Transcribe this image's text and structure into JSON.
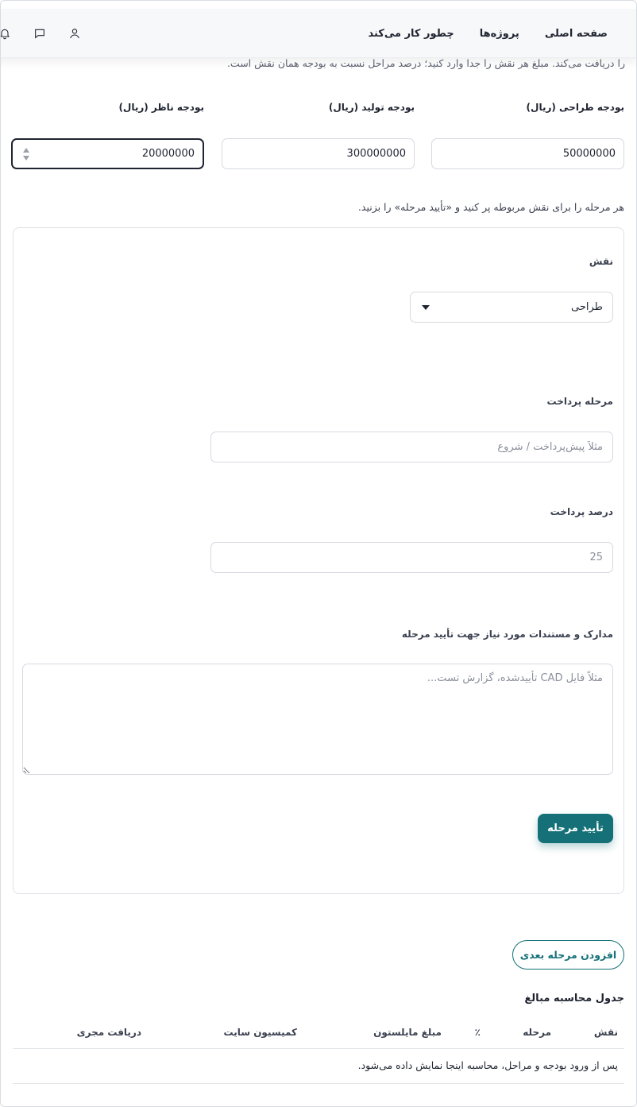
{
  "header": {
    "nav": [
      {
        "label": "صفحه اصلی"
      },
      {
        "label": "پروژه‌ها"
      },
      {
        "label": "چطور کار می‌کند"
      }
    ],
    "icons": [
      "user-icon",
      "message-icon",
      "bell-icon"
    ]
  },
  "intro": {
    "text": "را دریافت می‌کند. مبلغ هر نقش را جدا وارد کنید؛ درصد مراحل نسبت به بودجه همان نقش است."
  },
  "budgets": {
    "design": {
      "label": "بودجه طراحی (ریال)",
      "value": "50000000"
    },
    "production": {
      "label": "بودجه تولید (ریال)",
      "value": "300000000"
    },
    "supervisor": {
      "label": "بودجه ناظر (ریال)",
      "value": "20000000"
    }
  },
  "hint": "هر مرحله را برای نقش مربوطه پر کنید و «تأیید مرحله» را بزنید.",
  "stage_form": {
    "role_label": "نقش",
    "role_value": "طراحی",
    "stage_label": "مرحله پرداخت",
    "stage_placeholder": "مثلاً پیش‌پرداخت / شروع",
    "percent_label": "درصد پرداخت",
    "percent_placeholder": "25",
    "docs_label": "مدارک و مستندات مورد نیاز جهت تأیید مرحله",
    "docs_placeholder": "مثلاً فایل CAD تأییدشده، گزارش تست...",
    "confirm_label": "تأیید مرحله"
  },
  "add_stage_label": "افزودن مرحله بعدی",
  "table": {
    "title": "جدول محاسبه مبالغ",
    "columns": [
      "نقش",
      "مرحله",
      "٪",
      "مبلغ مایلستون",
      "کمیسیون سایت",
      "دریافت مجری"
    ],
    "empty_text": "پس از ورود بودجه و مراحل، محاسبه اینجا نمایش داده می‌شود."
  }
}
